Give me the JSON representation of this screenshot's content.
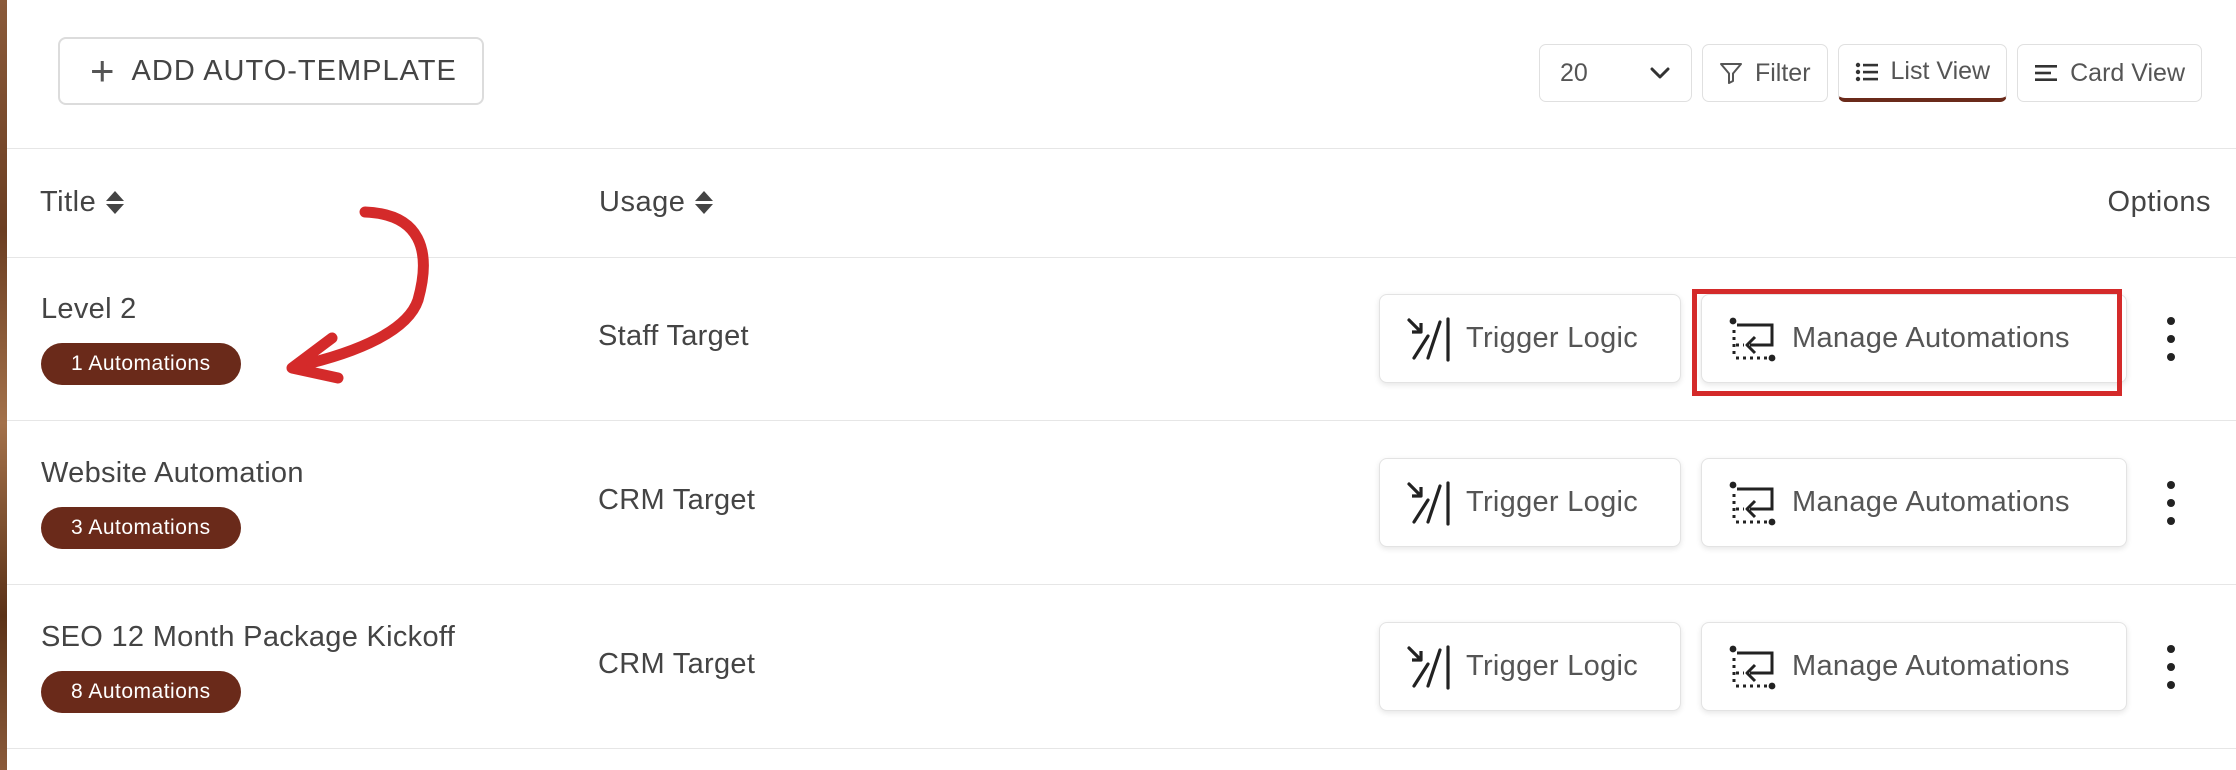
{
  "toolbar": {
    "add_label": "ADD AUTO-TEMPLATE",
    "page_size": "20",
    "filter_label": "Filter",
    "list_view_label": "List View",
    "card_view_label": "Card View"
  },
  "columns": {
    "title": "Title",
    "usage": "Usage",
    "options": "Options"
  },
  "rows": [
    {
      "title": "Level 2",
      "badge": "1 Automations",
      "usage": "Staff Target",
      "trigger_label": "Trigger Logic",
      "manage_label": "Manage Automations"
    },
    {
      "title": "Website Automation",
      "badge": "3 Automations",
      "usage": "CRM Target",
      "trigger_label": "Trigger Logic",
      "manage_label": "Manage Automations"
    },
    {
      "title": "SEO 12 Month Package Kickoff",
      "badge": "8 Automations",
      "usage": "CRM Target",
      "trigger_label": "Trigger Logic",
      "manage_label": "Manage Automations"
    }
  ],
  "colors": {
    "badge": "#6a2a1a",
    "highlight": "#d42a2a"
  },
  "icons": [
    "plus-icon",
    "chevron-down-icon",
    "filter-icon",
    "list-icon",
    "card-icon",
    "sort-icon",
    "trigger-icon",
    "automation-icon",
    "kebab-icon",
    "arrow-annotation"
  ]
}
